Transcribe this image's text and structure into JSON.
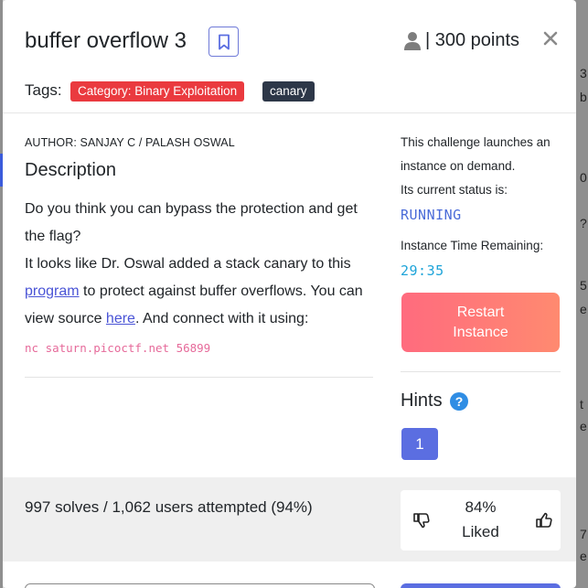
{
  "challenge": {
    "title": "buffer overflow 3",
    "points": "| 300 points",
    "tags_label": "Tags:",
    "tags": [
      "Category: Binary Exploitation",
      "canary"
    ],
    "author": "AUTHOR: SANJAY C / PALASH OSWAL",
    "description_heading": "Description",
    "description": {
      "part1": "Do you think you can bypass the protection and get the flag?",
      "part2": "It looks like Dr. Oswal added a stack canary to this ",
      "link_program": "program",
      "part3": " to protect against buffer overflows. You can view source ",
      "link_here": "here",
      "part4": ". And connect with it using:"
    },
    "command": "nc saturn.picoctf.net 56899"
  },
  "instance": {
    "launch_text_1": "This challenge launches an",
    "launch_text_2": "instance on demand.",
    "status_text": "Its current status is:",
    "status": "RUNNING",
    "time_label": "Instance Time Remaining:",
    "time_remaining": "29:35",
    "restart_line1": "Restart",
    "restart_line2": "Instance"
  },
  "hints": {
    "label": "Hints",
    "help_glyph": "?",
    "items": [
      "1"
    ]
  },
  "stats": {
    "solves": "997 solves / 1,062 users attempted (94%)",
    "liked_pct": "84%",
    "liked_label": "Liked"
  },
  "backdrop": {
    "fragments": [
      "3",
      "b",
      "0",
      "?",
      "5",
      "e",
      "t",
      "e",
      "7",
      "e"
    ]
  },
  "icons": {
    "bookmark": "bookmark-icon",
    "user": "user-icon",
    "close": "close-icon",
    "help": "help-circle-icon",
    "thumbs_down": "thumbs-down-icon",
    "thumbs_up": "thumbs-up-icon"
  },
  "colors": {
    "tag_category": "#ea3a3f",
    "tag_canary": "#2d3748",
    "status_running": "#4a6bd8",
    "timer": "#1ea4d9",
    "restart_gradient_start": "#ff6b7e",
    "restart_gradient_end": "#ff8a70",
    "hint_button": "#5b6ee1",
    "command_text": "#e66a9a"
  }
}
